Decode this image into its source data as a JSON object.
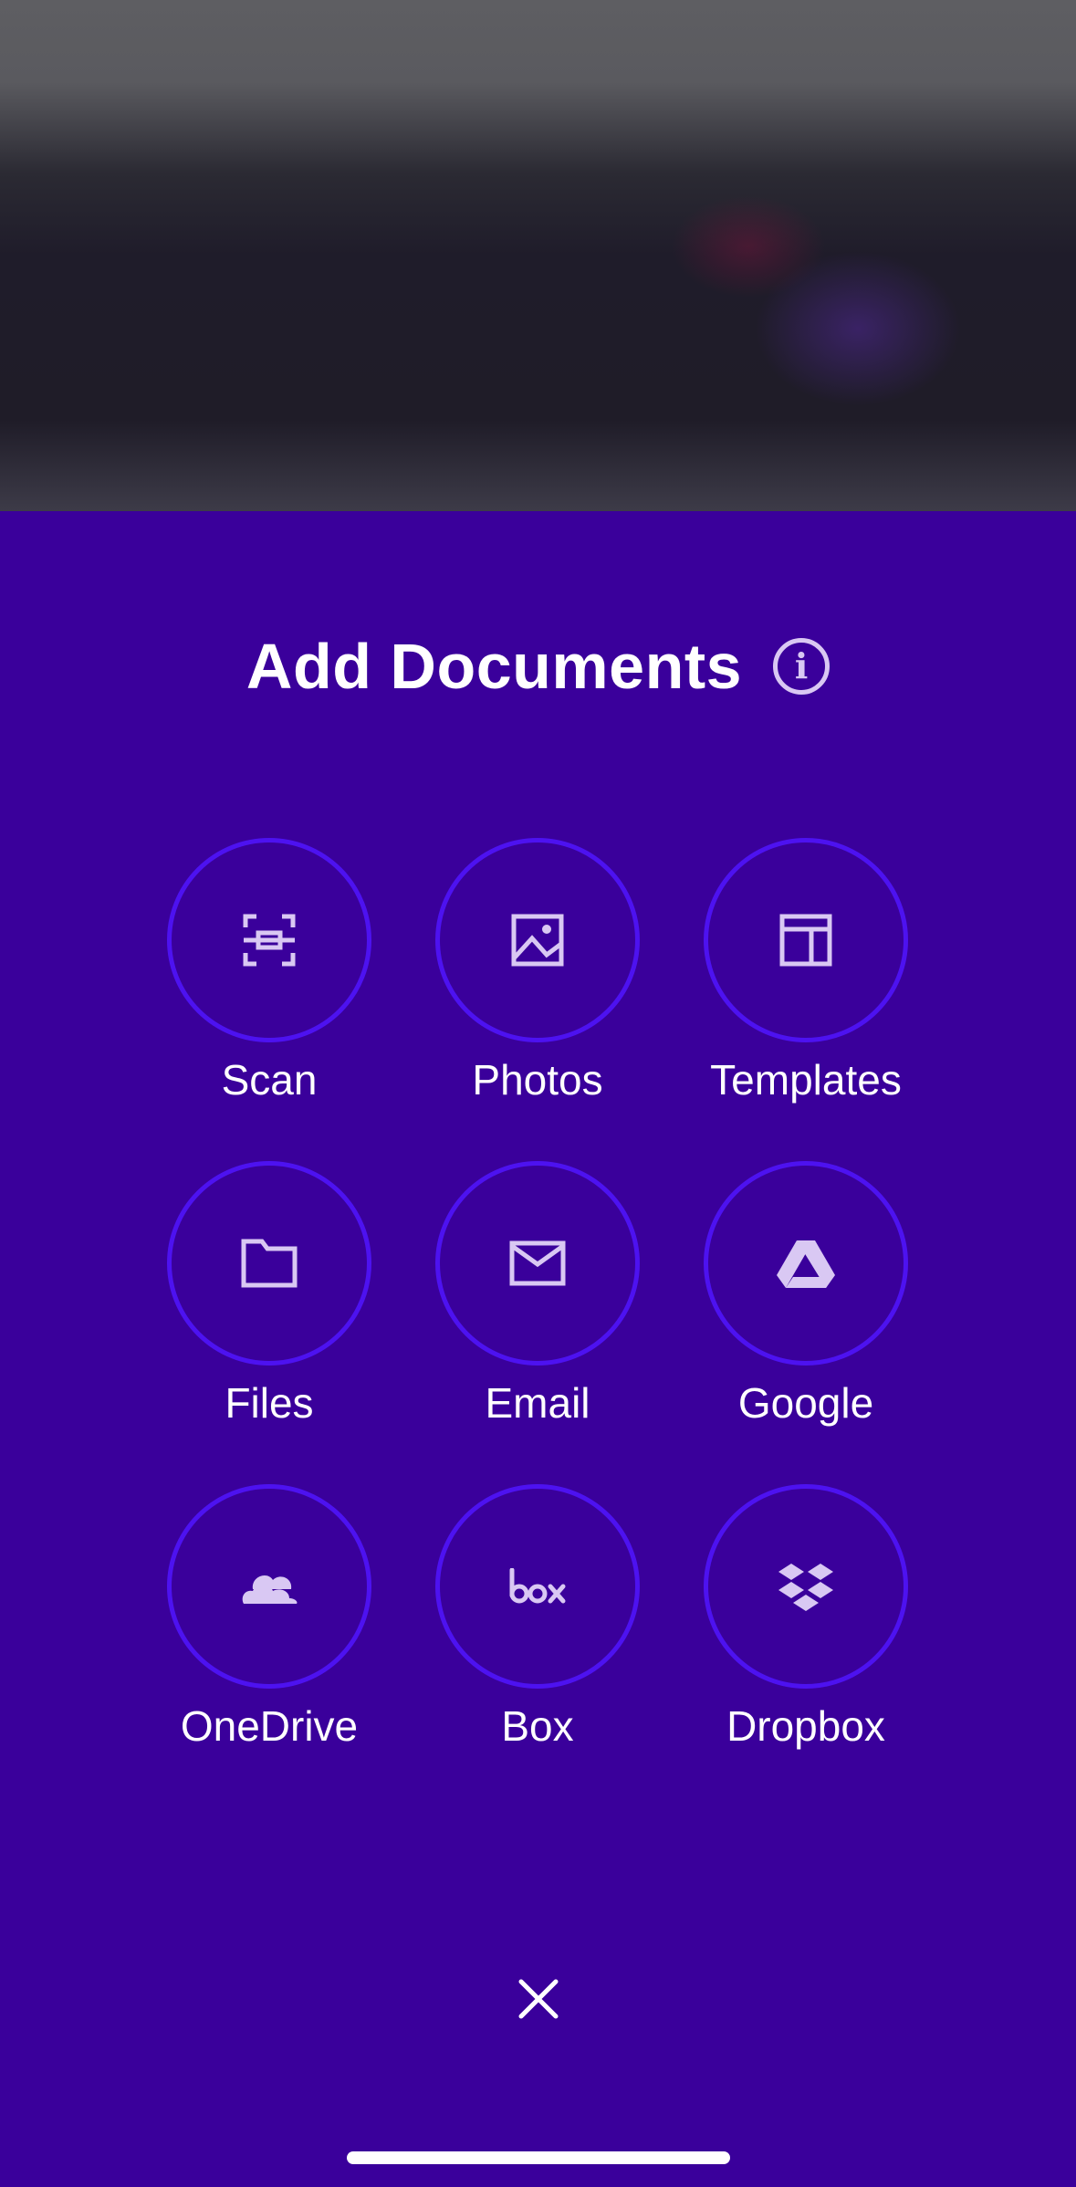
{
  "sheet": {
    "title": "Add Documents",
    "info_icon": "info-icon",
    "info_glyph": "i",
    "close_icon": "close-icon"
  },
  "options": [
    {
      "label": "Scan",
      "icon": "scan-icon"
    },
    {
      "label": "Photos",
      "icon": "photo-icon"
    },
    {
      "label": "Templates",
      "icon": "template-icon"
    },
    {
      "label": "Files",
      "icon": "folder-icon"
    },
    {
      "label": "Email",
      "icon": "email-icon"
    },
    {
      "label": "Google",
      "icon": "google-drive-icon"
    },
    {
      "label": "OneDrive",
      "icon": "onedrive-icon"
    },
    {
      "label": "Box",
      "icon": "box-icon"
    },
    {
      "label": "Dropbox",
      "icon": "dropbox-icon"
    }
  ],
  "colors": {
    "sheet_background": "#3a009b",
    "circle_border": "#4d12f0",
    "icon": "#d9c8f3",
    "text": "#ffffff"
  }
}
